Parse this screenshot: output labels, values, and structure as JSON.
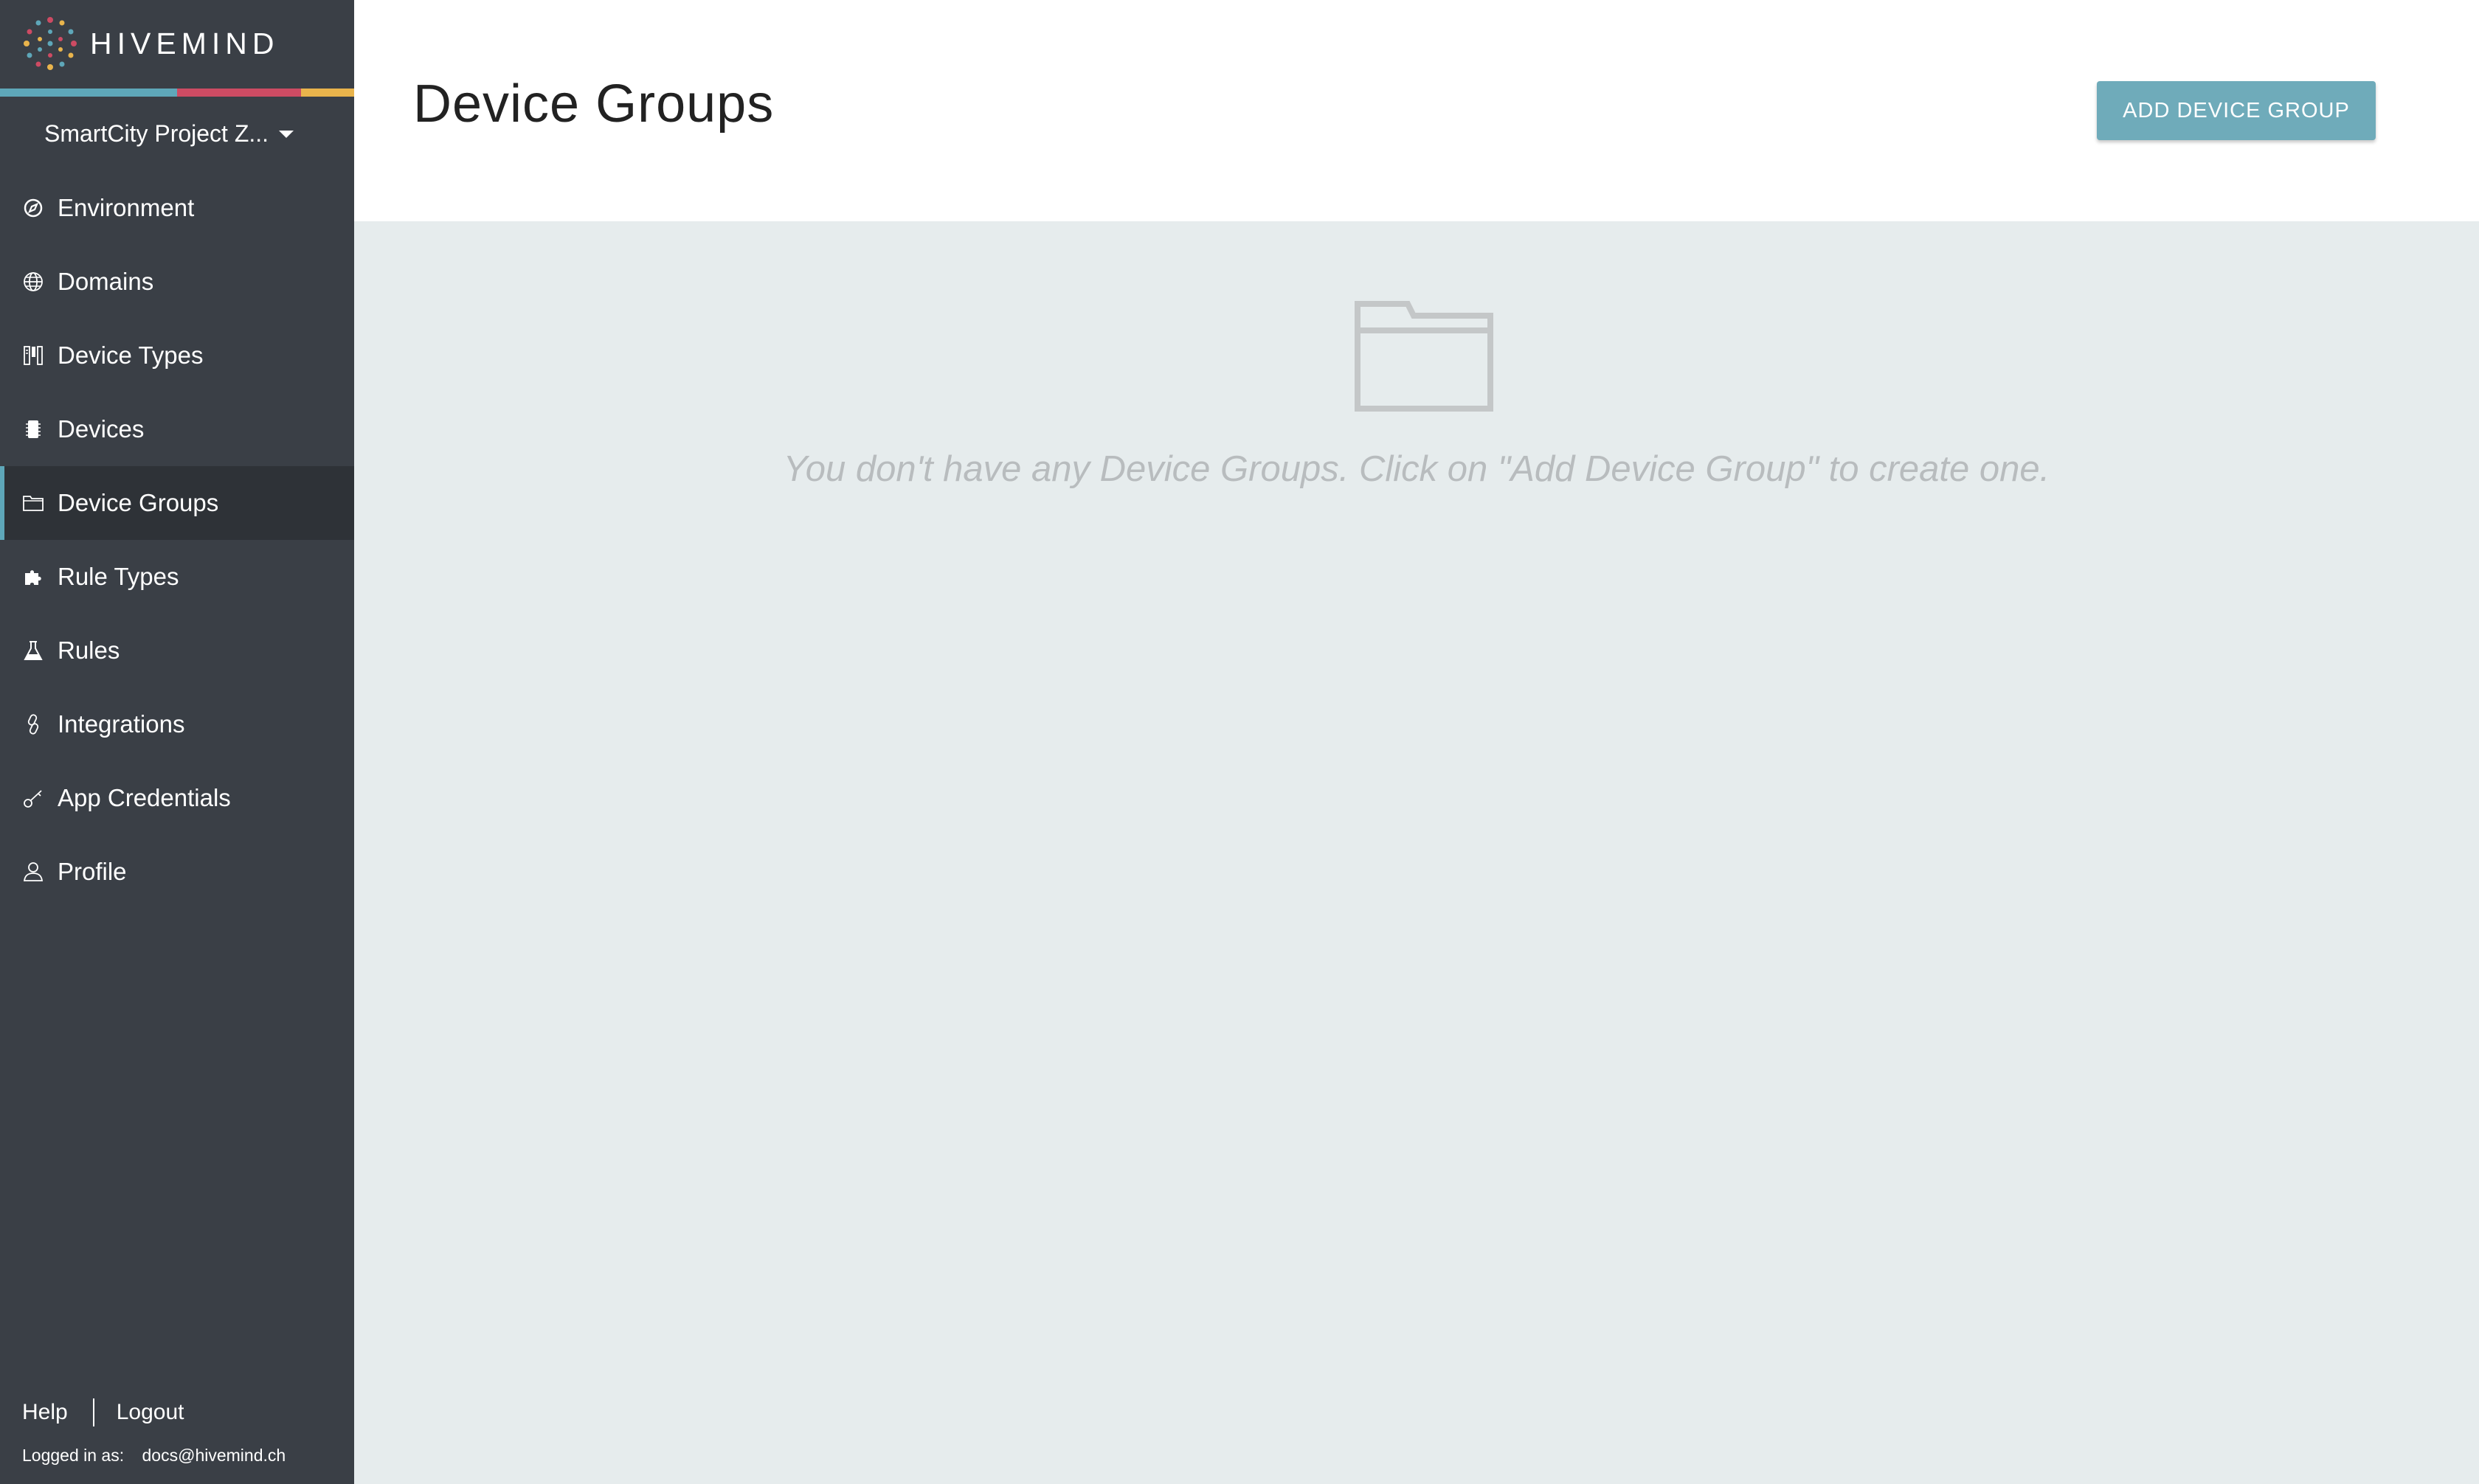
{
  "app": {
    "name": "HIVEMIND",
    "stripe_colors": [
      "#5ea7b9",
      "#cd4b63",
      "#e9b44c"
    ]
  },
  "sidebar": {
    "project": "SmartCity Project Z...",
    "items": [
      {
        "label": "Environment",
        "icon": "compass-icon",
        "active": false
      },
      {
        "label": "Domains",
        "icon": "globe-icon",
        "active": false
      },
      {
        "label": "Device Types",
        "icon": "device-types-icon",
        "active": false
      },
      {
        "label": "Devices",
        "icon": "chip-icon",
        "active": false
      },
      {
        "label": "Device Groups",
        "icon": "folder-icon",
        "active": true
      },
      {
        "label": "Rule Types",
        "icon": "puzzle-icon",
        "active": false
      },
      {
        "label": "Rules",
        "icon": "flask-icon",
        "active": false
      },
      {
        "label": "Integrations",
        "icon": "link-icon",
        "active": false
      },
      {
        "label": "App Credentials",
        "icon": "key-icon",
        "active": false
      },
      {
        "label": "Profile",
        "icon": "user-icon",
        "active": false
      }
    ],
    "help": "Help",
    "logout": "Logout",
    "logged_in_label": "Logged in as:",
    "logged_in_email": "docs@hivemind.ch"
  },
  "header": {
    "title": "Device Groups",
    "add_button": "ADD DEVICE GROUP"
  },
  "main": {
    "empty_message": "You don't have any Device Groups. Click on \"Add Device Group\" to create one.",
    "empty_icon": "folder-icon"
  },
  "colors": {
    "sidebar_bg": "#3a3f46",
    "active_item_bg": "#2e3237",
    "accent": "#6fabba",
    "content_bg": "#e6eced"
  }
}
